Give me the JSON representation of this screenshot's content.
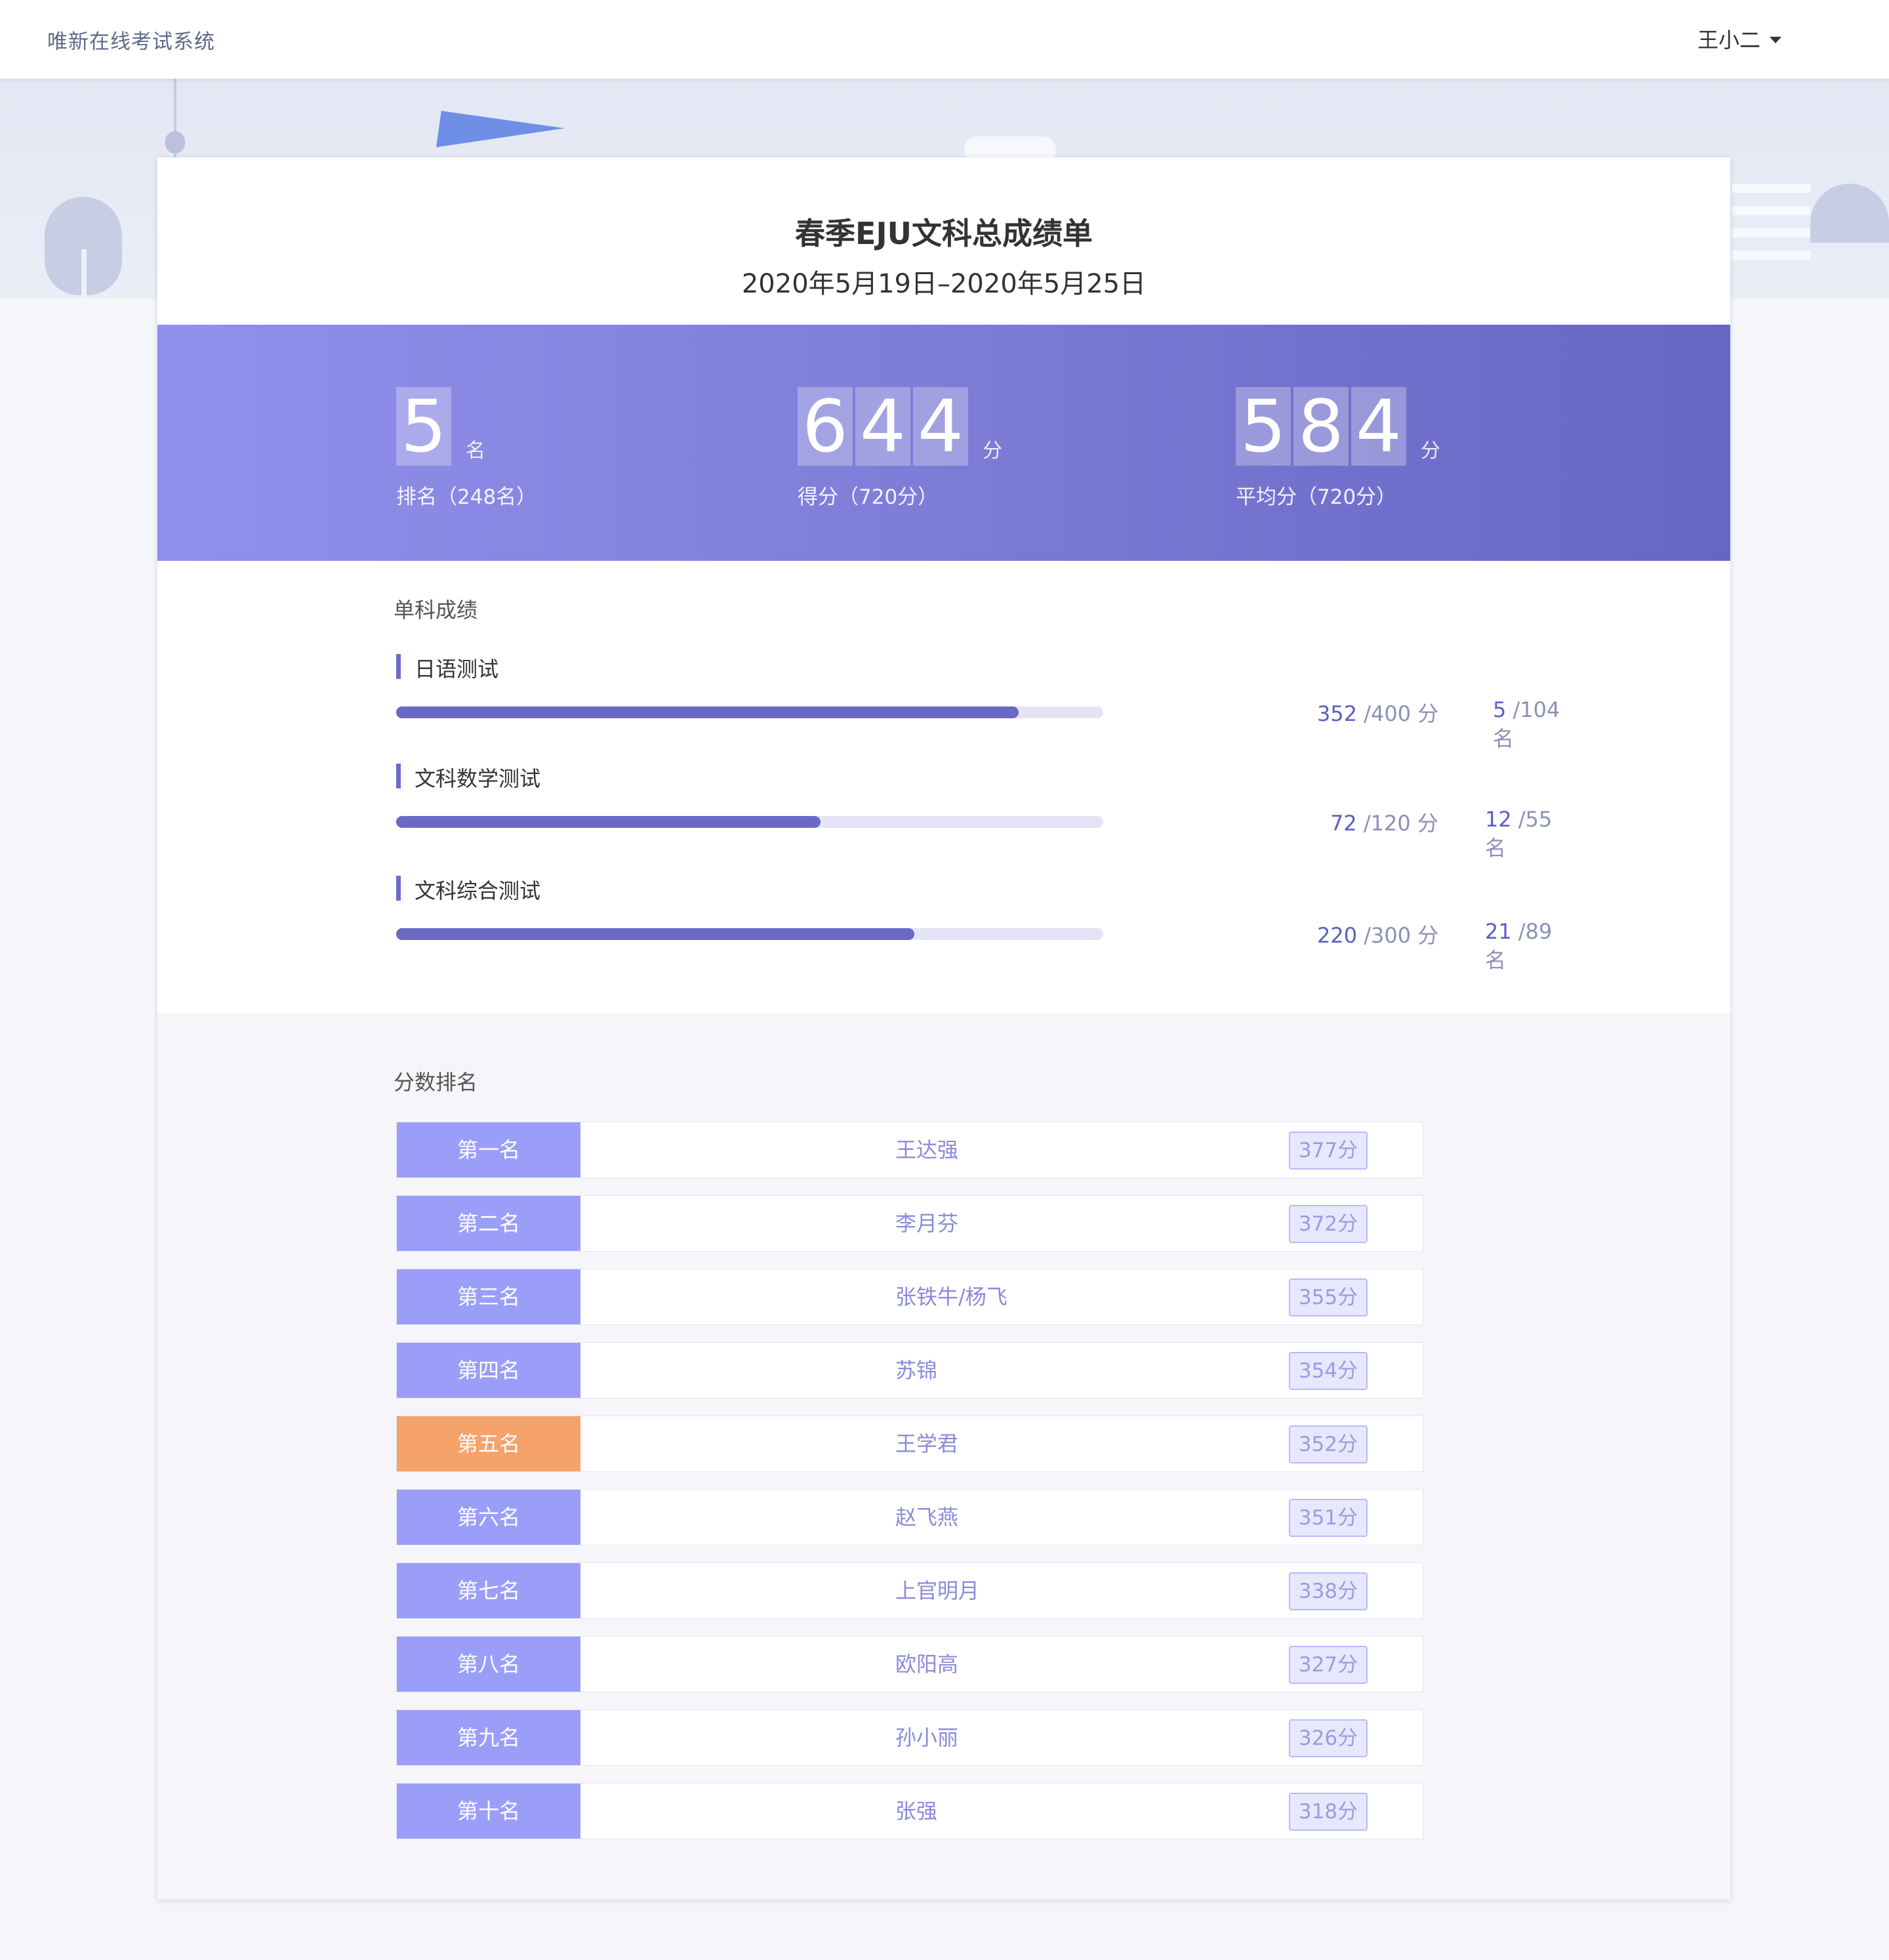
{
  "header": {
    "brand": "唯新在线考试系统",
    "user": "王小二"
  },
  "report": {
    "title": "春季EJU文科总成绩单",
    "date_range": "2020年5月19日–2020年5月25日"
  },
  "stats": {
    "rank": {
      "digits": [
        "5"
      ],
      "unit": "名",
      "label": "排名（248名）"
    },
    "score": {
      "digits": [
        "6",
        "4",
        "4"
      ],
      "unit": "分",
      "label": "得分（720分）"
    },
    "average": {
      "digits": [
        "5",
        "8",
        "4"
      ],
      "unit": "分",
      "label": "平均分（720分）"
    }
  },
  "subjects_section": {
    "title": "单科成绩",
    "items": [
      {
        "name": "日语测试",
        "score": "352",
        "total": "/400 分",
        "rank": "5",
        "rank_total": "/104 名",
        "fraction": 0.88
      },
      {
        "name": "文科数学测试",
        "score": "72",
        "total": "/120 分",
        "rank": "12",
        "rank_total": "/55 名",
        "fraction": 0.6
      },
      {
        "name": "文科综合测试",
        "score": "220",
        "total": "/300 分",
        "rank": "21",
        "rank_total": "/89 名",
        "fraction": 0.733
      }
    ]
  },
  "ranking_section": {
    "title": "分数排名",
    "rows": [
      {
        "place": "第一名",
        "name": "王达强",
        "score": "377分"
      },
      {
        "place": "第二名",
        "name": "李月芬",
        "score": "372分"
      },
      {
        "place": "第三名",
        "name": "张铁牛/杨飞",
        "score": "355分"
      },
      {
        "place": "第四名",
        "name": "苏锦",
        "score": "354分"
      },
      {
        "place": "第五名",
        "name": "王学君",
        "score": "352分",
        "highlight": true
      },
      {
        "place": "第六名",
        "name": "赵飞燕",
        "score": "351分"
      },
      {
        "place": "第七名",
        "name": "上官明月",
        "score": "338分"
      },
      {
        "place": "第八名",
        "name": "欧阳高",
        "score": "327分"
      },
      {
        "place": "第九名",
        "name": "孙小丽",
        "score": "326分"
      },
      {
        "place": "第十名",
        "name": "张强",
        "score": "318分"
      }
    ]
  },
  "colors": {
    "accent": "#6a69c6",
    "rank_badge": "#9b9ef9",
    "rank_badge_self": "#f5a26b"
  }
}
